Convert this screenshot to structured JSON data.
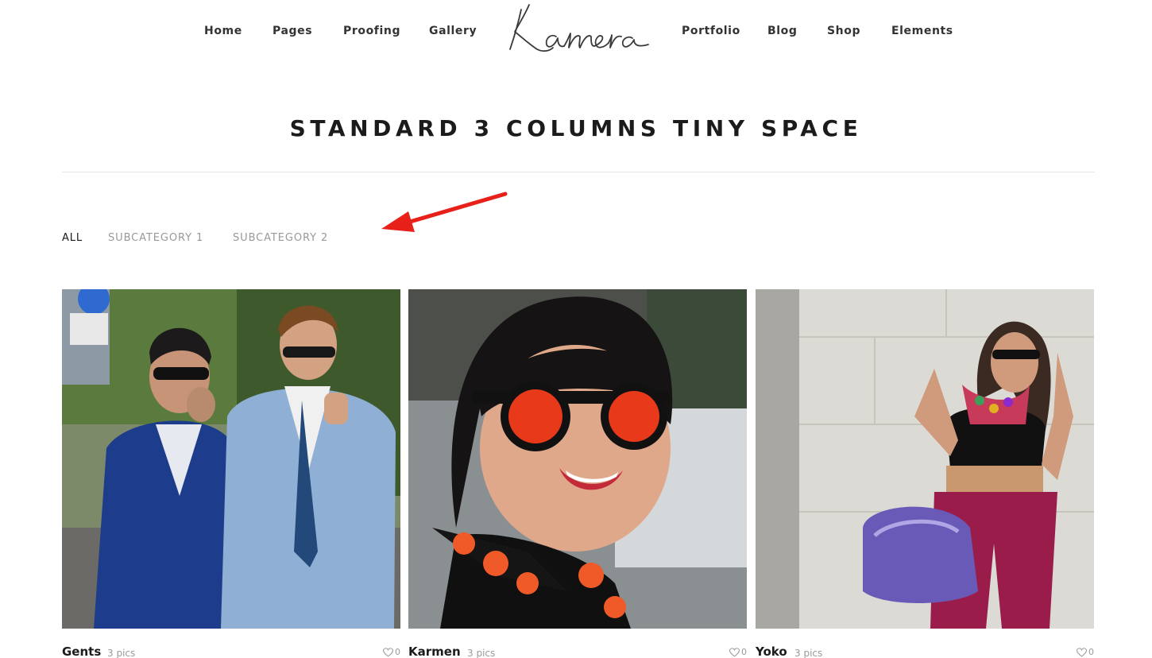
{
  "header": {
    "nav_left": [
      "Home",
      "Pages",
      "Proofing",
      "Gallery"
    ],
    "logo_text": "Kamera",
    "nav_right": [
      "Portfolio",
      "Blog",
      "Shop",
      "Elements"
    ]
  },
  "page": {
    "title": "STANDARD 3 COLUMNS TINY SPACE"
  },
  "filters": {
    "items": [
      "ALL",
      "SUBCATEGORY 1",
      "SUBCATEGORY 2"
    ],
    "active": "ALL"
  },
  "gallery": {
    "items": [
      {
        "title": "Gents",
        "count": "3 pics",
        "likes": "0"
      },
      {
        "title": "Karmen",
        "count": "3 pics",
        "likes": "0"
      },
      {
        "title": "Yoko",
        "count": "3 pics",
        "likes": "0"
      }
    ]
  },
  "colors": {
    "annotation_arrow": "#e8201a",
    "text_dark": "#1b1b1b",
    "text_muted": "#999999"
  }
}
